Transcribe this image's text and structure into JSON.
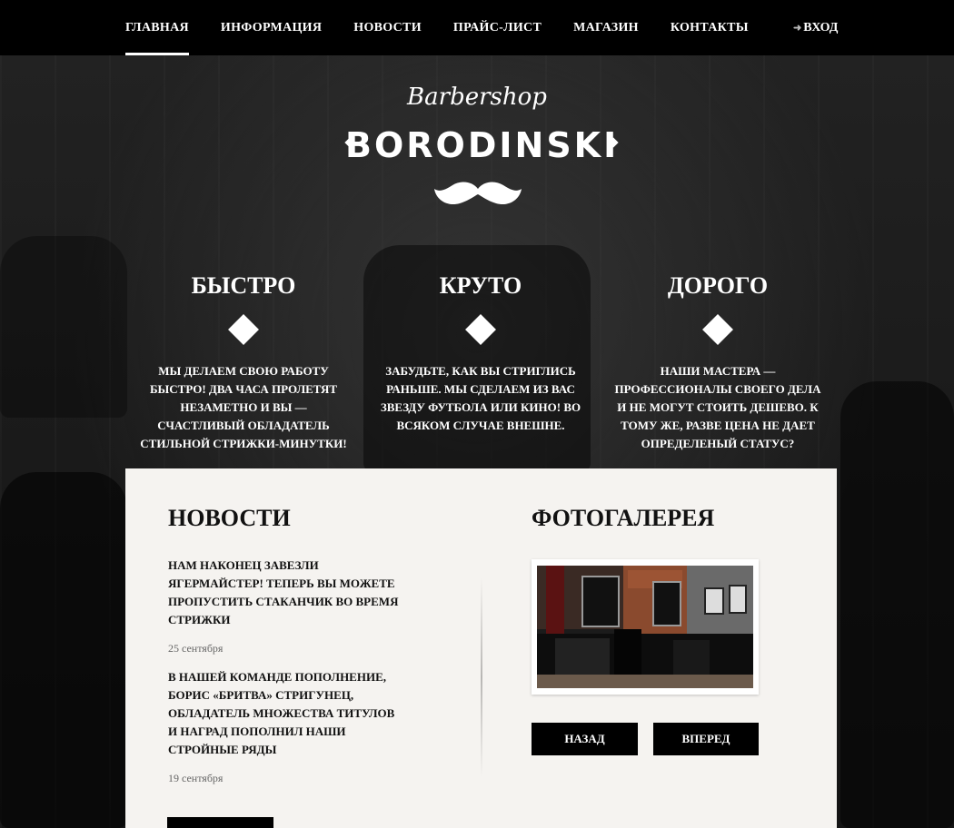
{
  "nav": {
    "items": [
      {
        "label": "ГЛАВНАЯ",
        "active": true
      },
      {
        "label": "ИНФОРМАЦИЯ",
        "active": false
      },
      {
        "label": "НОВОСТИ",
        "active": false
      },
      {
        "label": "ПРАЙС-ЛИСТ",
        "active": false
      },
      {
        "label": "МАГАЗИН",
        "active": false
      },
      {
        "label": "КОНТАКТЫ",
        "active": false
      }
    ],
    "login_label": "ВХОД",
    "login_icon": "sign-in-arrow-icon"
  },
  "logo": {
    "script": "Barbershop",
    "main": "BORODINSKI",
    "icon": "mustache-icon"
  },
  "features": [
    {
      "title": "БЫСТРО",
      "text": "Мы делаем свою работу быстро! Два часа пролетят незаметно и вы — счастливый обладатель стильной стрижки-минутки!"
    },
    {
      "title": "КРУТО",
      "text": "Забудьте, как вы стриглись раньше. Мы сделаем из вас звезду футбола или кино! Во всяком случае внешне."
    },
    {
      "title": "ДОРОГО",
      "text": "Наши мастера — профессионалы своего дела и не могут стоить дешево. К тому же, разве цена не дает определеный статус?"
    }
  ],
  "news": {
    "title": "НОВОСТИ",
    "items": [
      {
        "text": "Нам наконец завезли Ягермайстер! Теперь вы можете пропустить стаканчик во время стрижки",
        "date": "25 сентября"
      },
      {
        "text": "В нашей команде пополнение, Борис «Бритва» Стригунец, обладатель множества титулов и наград пополнил наши стройные ряды",
        "date": "19 сентября"
      }
    ]
  },
  "gallery": {
    "title": "ФОТОГАЛЕРЕЯ",
    "prev_label": "НАЗАД",
    "next_label": "ВПЕРЕД"
  },
  "colors": {
    "panel_bg": "#f5f3f0",
    "accent": "#000000",
    "text_light": "#ffffff"
  }
}
